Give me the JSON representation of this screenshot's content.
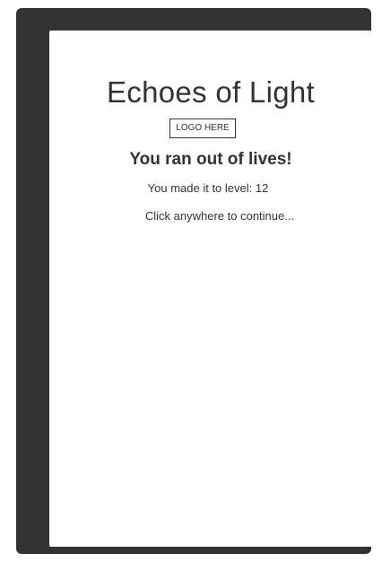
{
  "game_over_screen": {
    "title": "Echoes of Light",
    "logo_label": "LOGO HERE",
    "message": "You ran out of lives!",
    "level_text": "You made it to level: 12",
    "continue_prompt": "Click anywhere to continue..."
  }
}
